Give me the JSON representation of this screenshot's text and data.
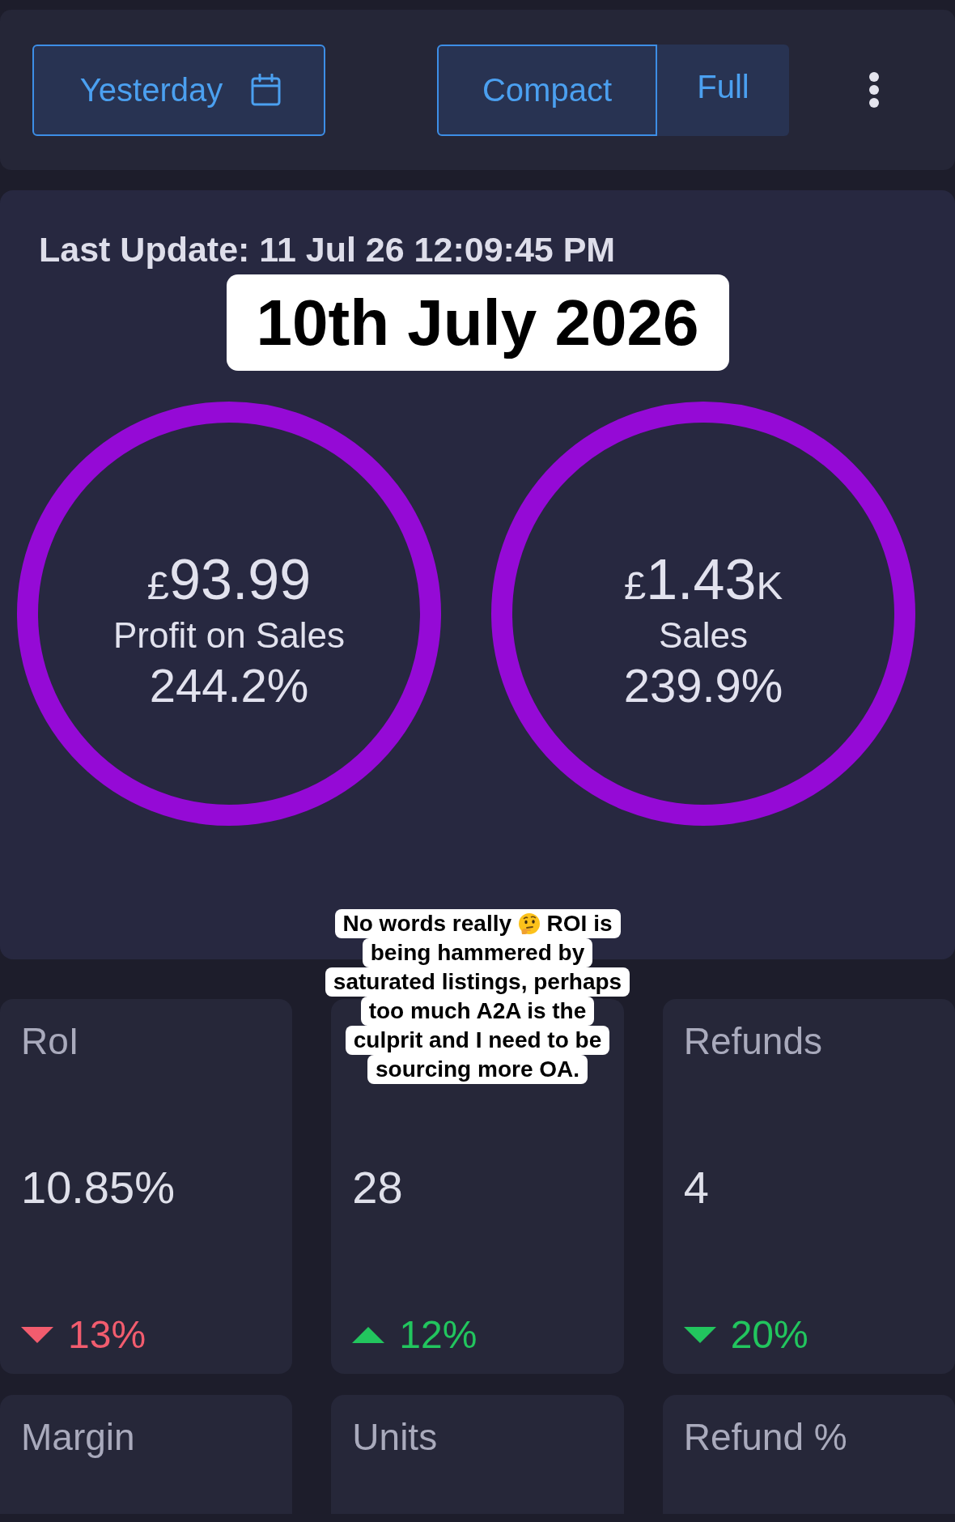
{
  "toolbar": {
    "date_range": {
      "label": "Yesterday"
    },
    "view_modes": [
      {
        "label": "Compact",
        "selected": true
      },
      {
        "label": "Full",
        "selected": false
      }
    ]
  },
  "summary": {
    "last_update": "Last Update: 11 Jul 26 12:09:45 PM",
    "date_label": "10th July 2026",
    "metrics": [
      {
        "currency": "£",
        "amount": "93.99",
        "name": "Profit on Sales",
        "percent": "244.2%"
      },
      {
        "currency": "£",
        "amount": "1.43",
        "suffix": "K",
        "name": "Sales",
        "percent": "239.9%"
      }
    ]
  },
  "caption": {
    "lines": [
      {
        "parts": [
          {
            "kind": "text",
            "text": "No words really"
          },
          {
            "kind": "emoji"
          },
          {
            "kind": "text",
            "text": "ROI is"
          }
        ]
      },
      {
        "parts": [
          {
            "kind": "text",
            "text": "being hammered by"
          }
        ]
      },
      {
        "parts": [
          {
            "kind": "text",
            "text": "saturated listings, perhaps"
          }
        ]
      },
      {
        "parts": [
          {
            "kind": "text",
            "text": "too much A2A is the"
          }
        ]
      },
      {
        "parts": [
          {
            "kind": "text",
            "text": "culprit and I need to be"
          }
        ]
      },
      {
        "parts": [
          {
            "kind": "text",
            "text": "sourcing more OA."
          }
        ]
      }
    ]
  },
  "stats": [
    {
      "label": "RoI",
      "value": "10.85%",
      "change": {
        "kind": "down",
        "color": "#f25c6e",
        "text": "13%"
      }
    },
    {
      "value": "28",
      "change": {
        "kind": "up",
        "color": "#22c55e",
        "text": "12%"
      }
    },
    {
      "label": "Refunds",
      "value": "4",
      "change": {
        "kind": "down",
        "color": "#22c55e",
        "text": "20%"
      }
    },
    {
      "label": "Margin"
    },
    {
      "label": "Units"
    },
    {
      "label": "Refund %"
    }
  ]
}
